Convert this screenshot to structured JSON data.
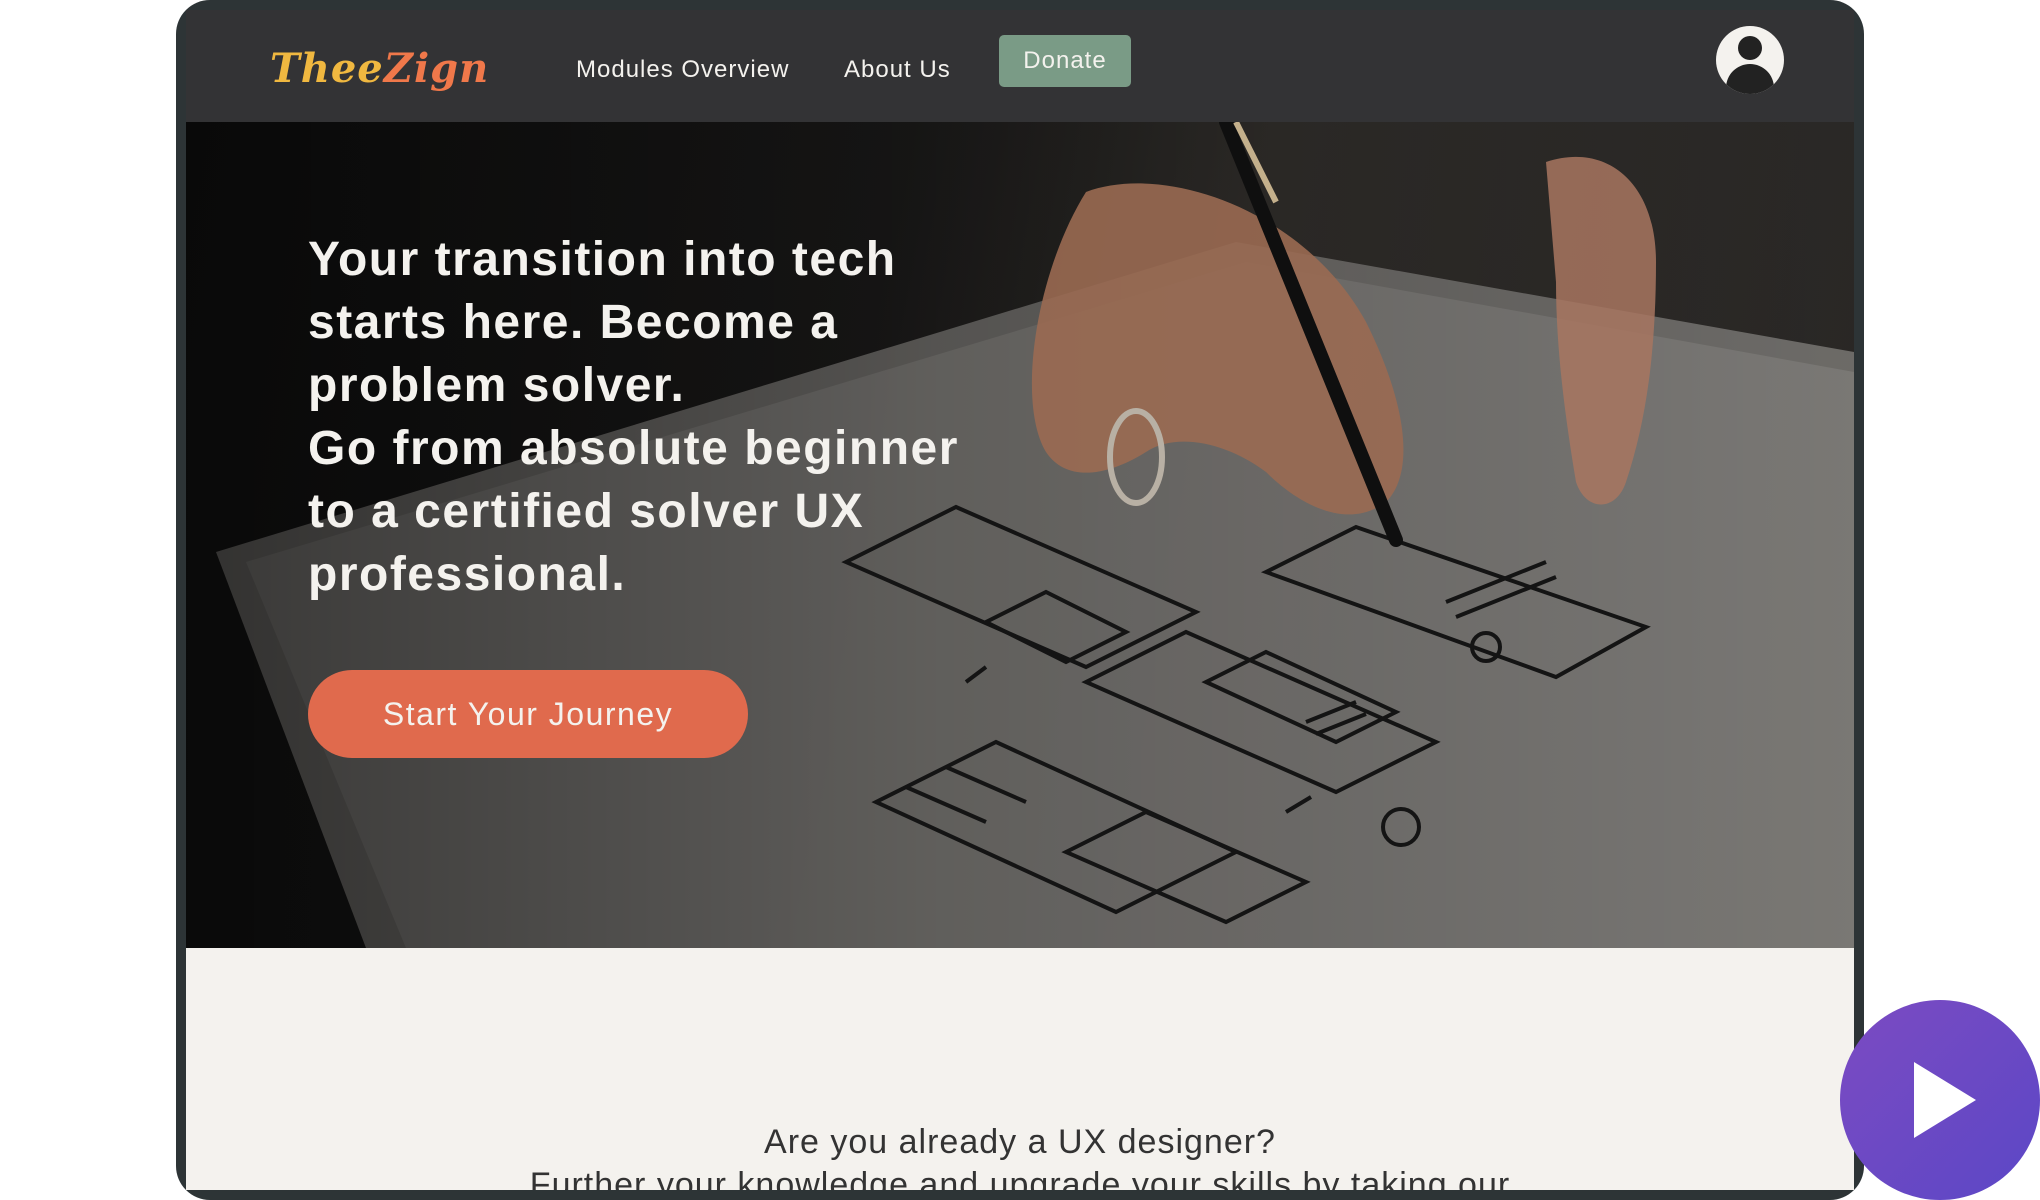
{
  "nav": {
    "logo_part1": "Thee",
    "logo_part2": "Zign",
    "links": [
      "Modules Overview",
      "About Us"
    ],
    "donate_label": "Donate",
    "avatar_icon": "user-avatar-icon"
  },
  "hero": {
    "lines": [
      "Your transition into tech",
      "starts here. Become a",
      "problem solver.",
      "Go from absolute beginner",
      "to a certified solver UX",
      "professional."
    ],
    "cta_label": "Start Your Journey"
  },
  "section": {
    "title": "Are you already a UX designer?",
    "body": "Further your knowledge and upgrade your skills by taking our"
  },
  "colors": {
    "nav_bg": "#333335",
    "accent_orange": "#e06a4d",
    "donate_green": "#7a9b86",
    "play_purple": "#6a4ac4"
  },
  "fab": {
    "icon": "play-icon"
  }
}
